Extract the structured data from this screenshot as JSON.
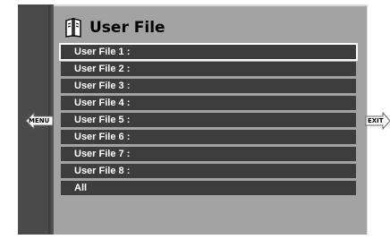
{
  "window": {
    "title": "User File"
  },
  "nav": {
    "left_label": "MENU",
    "right_label": "EXIT"
  },
  "icons": {
    "title_icon": "book-icon",
    "left_arrow": "left-arrow-icon",
    "right_arrow": "right-arrow-icon"
  },
  "colors": {
    "panel": "#a3a3a3",
    "row": "#3d3d3d",
    "row_text": "#ffffff",
    "selected_outline": "#ffffff"
  },
  "list": {
    "selected_index": 0,
    "items": [
      {
        "label": "User File 1 :"
      },
      {
        "label": "User File 2 :"
      },
      {
        "label": "User File 3 :"
      },
      {
        "label": "User File 4 :"
      },
      {
        "label": "User File 5 :"
      },
      {
        "label": "User File 6 :"
      },
      {
        "label": "User File 7 :"
      },
      {
        "label": "User File 8 :"
      },
      {
        "label": "All"
      }
    ]
  }
}
